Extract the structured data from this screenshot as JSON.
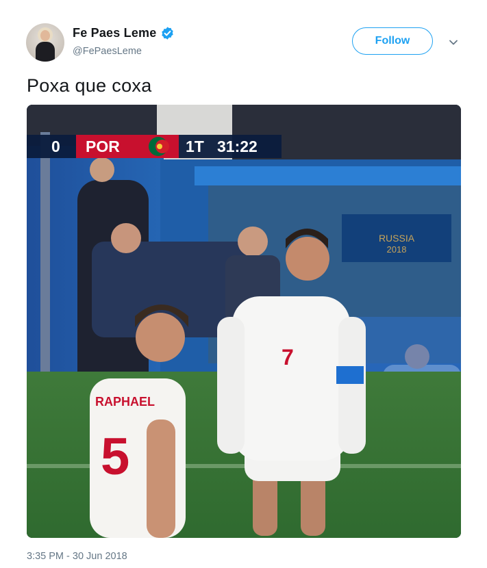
{
  "user": {
    "display_name": "Fe Paes Leme",
    "handle": "@FePaesLeme",
    "verified": true,
    "avatar_icon": "profile-photo"
  },
  "actions": {
    "follow_label": "Follow",
    "more_icon": "chevron-down-icon"
  },
  "tweet": {
    "text": "Poxa que coxa",
    "timestamp": "3:35 PM - 30 Jun 2018"
  },
  "media": {
    "description_icon": "match-photo",
    "scoreboard": {
      "home_score": "0",
      "team": "POR",
      "period": "1T",
      "clock": "31:22"
    },
    "board_text": {
      "line1": "RUSSIA",
      "line2": "2018"
    },
    "player_left": {
      "name": "RAPHAEL",
      "number": "5"
    },
    "player_right": {
      "number": "7"
    }
  },
  "colors": {
    "accent": "#1da1f2",
    "text_primary": "#14171a",
    "text_secondary": "#657786"
  }
}
